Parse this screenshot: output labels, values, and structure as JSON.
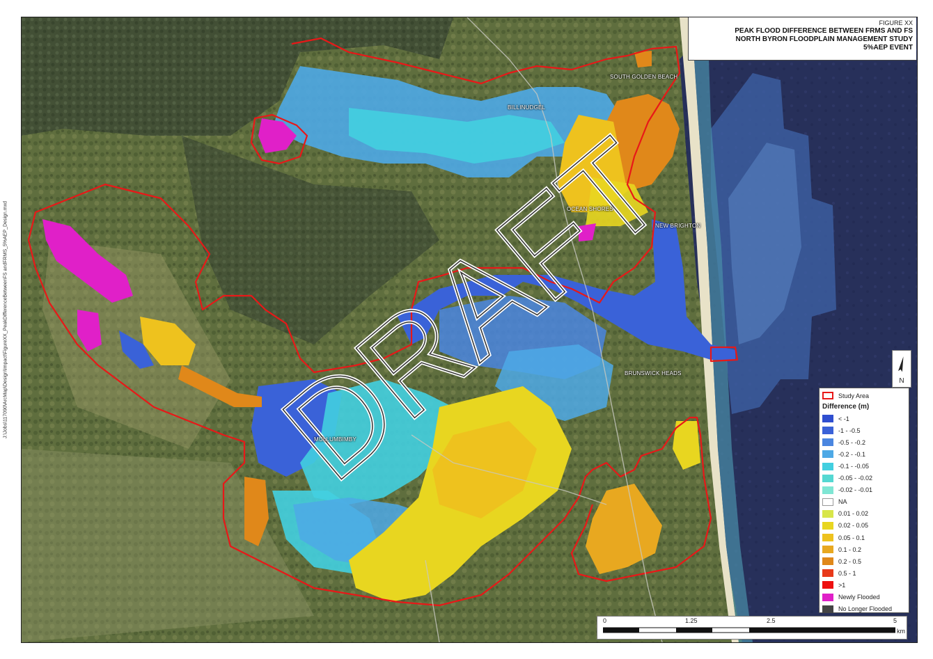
{
  "title": {
    "figure": "FIGURE XX",
    "line1": "PEAK FLOOD DIFFERENCE BETWEEN FRMS AND FS",
    "line2": "NORTH BYRON FLOODPLAIN MANAGEMENT STUDY",
    "line3": "5%AEP EVENT"
  },
  "watermark": "DRAFT",
  "places": {
    "south_golden_beach": "SOUTH GOLDEN BEACH",
    "billinudgel": "BILLINUDGEL",
    "ocean_shores": "OCEAN SHORES",
    "new_brighton": "NEW BRIGHTON",
    "brunswick_heads": "BRUNSWICK HEADS",
    "mullumbimby": "MULLUMBIMBY"
  },
  "legend": {
    "study_area": "Study Area",
    "heading": "Difference (m)",
    "classes": [
      {
        "label": "< -1",
        "color": "#2f4fd0"
      },
      {
        "label": "-1 - -0.5",
        "color": "#3a62d8"
      },
      {
        "label": "-0.5 - -0.2",
        "color": "#4a86e0"
      },
      {
        "label": "-0.2 - -0.1",
        "color": "#4ea9e6"
      },
      {
        "label": "-0.1 - -0.05",
        "color": "#42cfe0"
      },
      {
        "label": "-0.05 - -0.02",
        "color": "#55d8d2"
      },
      {
        "label": "-0.02 - -0.01",
        "color": "#7fe6d4"
      },
      {
        "label": "NA",
        "color": "#ffffff"
      },
      {
        "label": "0.01 - 0.02",
        "color": "#d8e64a"
      },
      {
        "label": "0.02 - 0.05",
        "color": "#e8d620"
      },
      {
        "label": "0.05 - 0.1",
        "color": "#eec21e"
      },
      {
        "label": "0.1 - 0.2",
        "color": "#e8a820"
      },
      {
        "label": "0.2 - 0.5",
        "color": "#e0881a"
      },
      {
        "label": "0.5 - 1",
        "color": "#e83a1a"
      },
      {
        "label": ">1",
        "color": "#ee1010"
      },
      {
        "label": "Newly Flooded",
        "color": "#e020c8"
      },
      {
        "label": "No Longer Flooded",
        "color": "#444444"
      }
    ]
  },
  "north": "N",
  "scale": {
    "ticks": [
      "0",
      "1.25",
      "2.5",
      "5"
    ],
    "unit": "km"
  },
  "file_path": "J:\\Jobs\\117090\\ArcMap\\Design\\Impact\\FigureXX_PeakDifferenceBetweenFS andFRMS_5%AEP_Design.mxd"
}
